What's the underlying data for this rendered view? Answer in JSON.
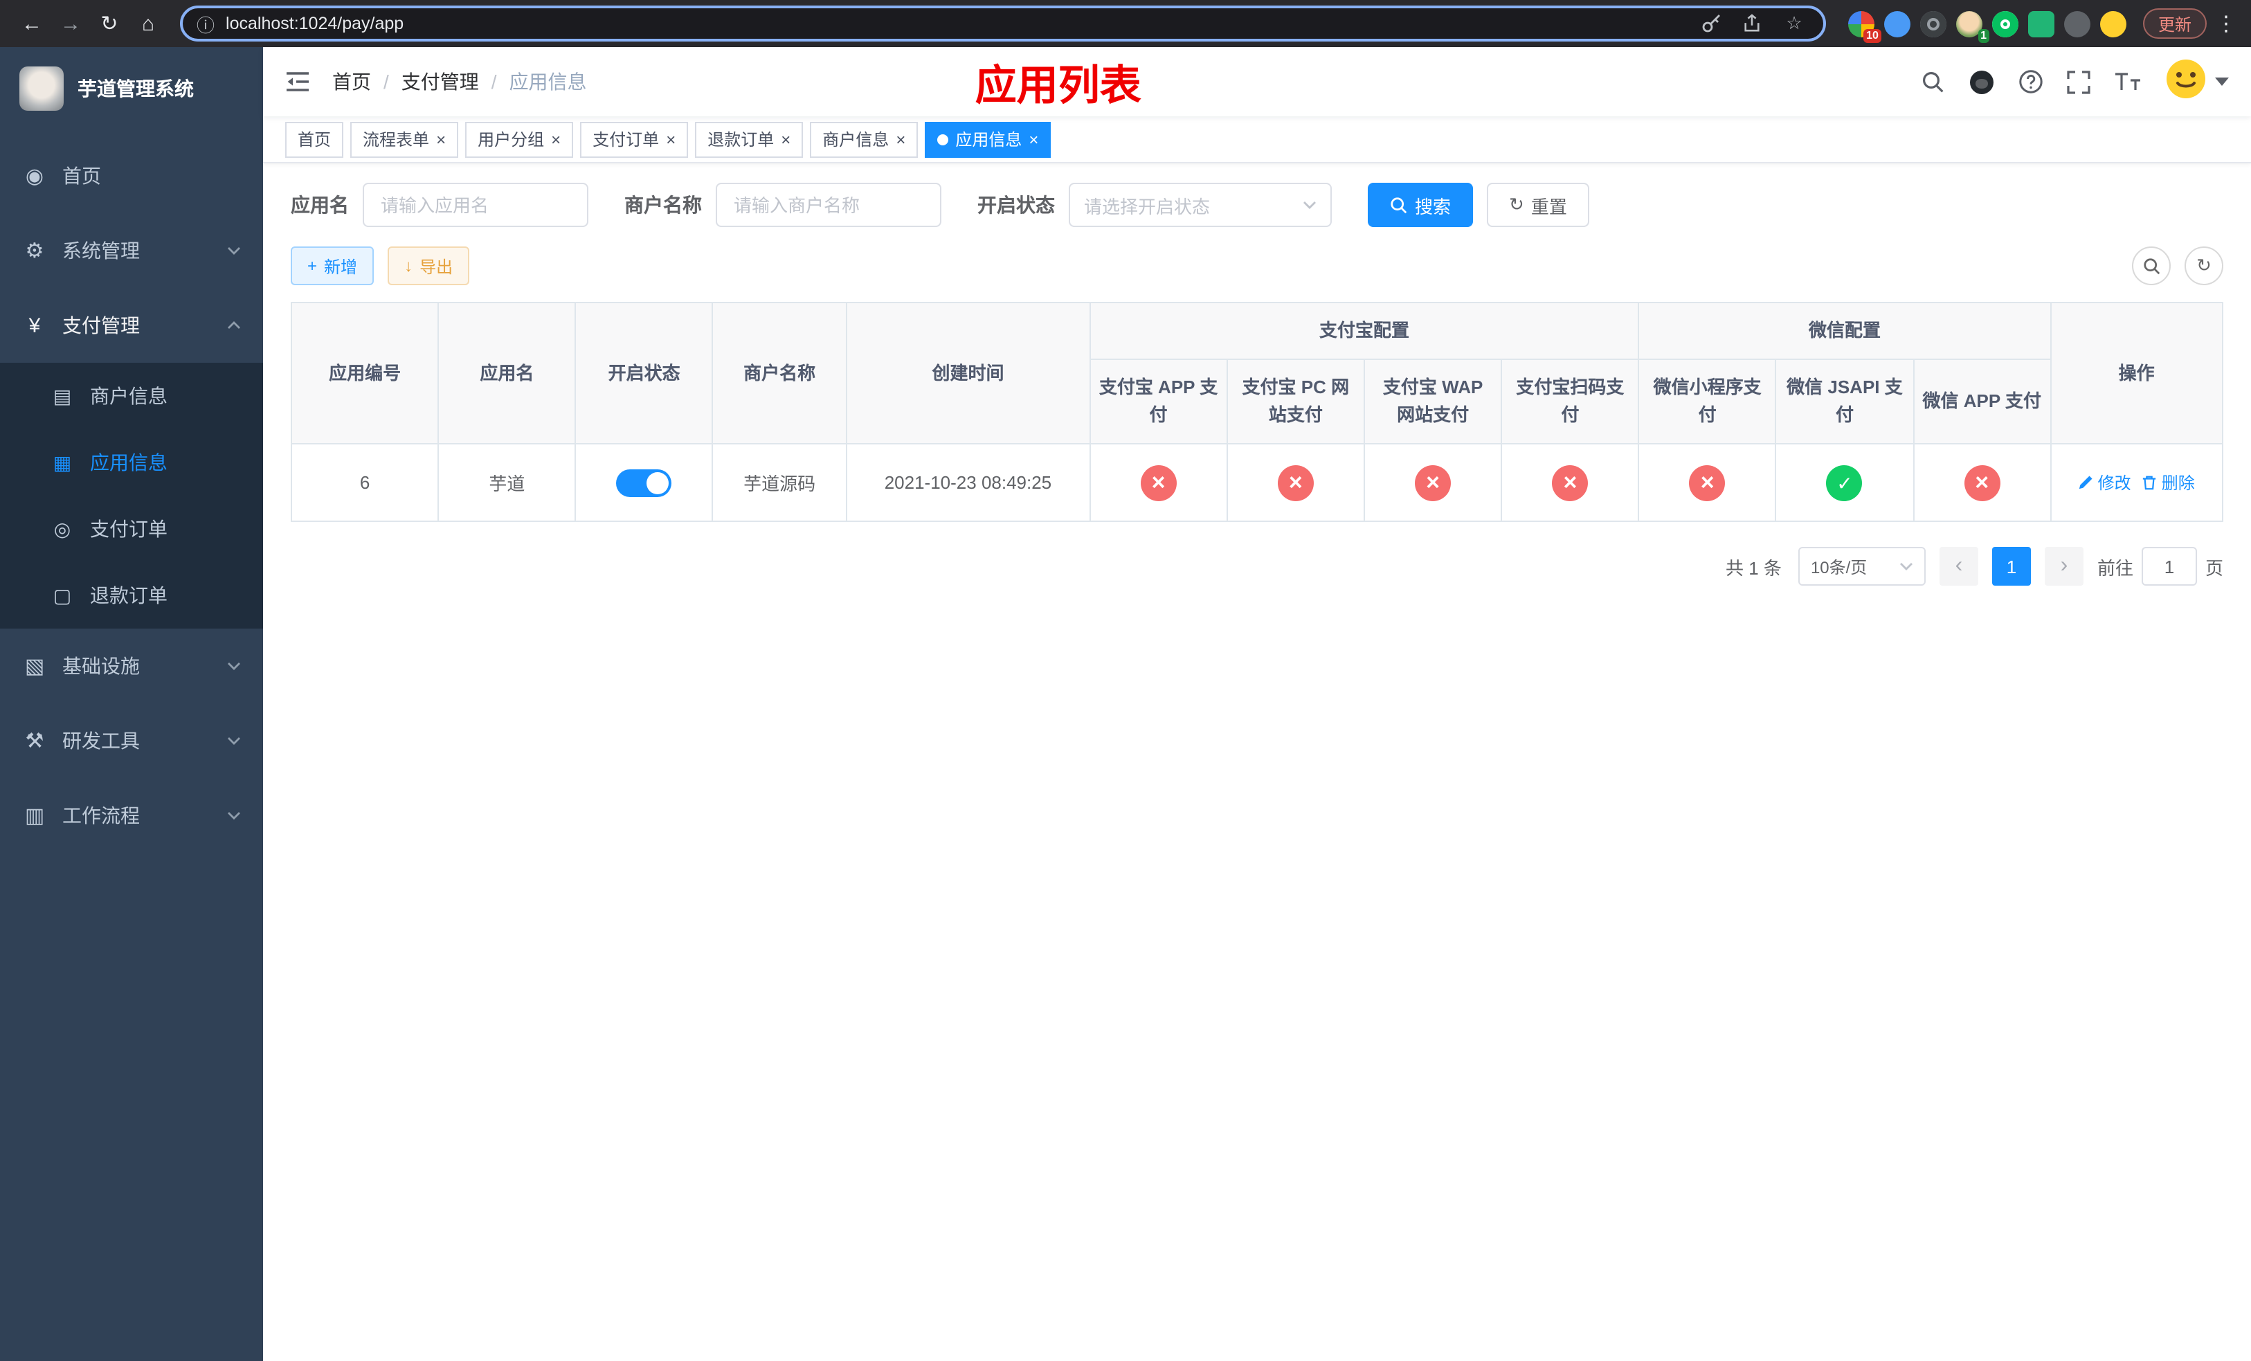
{
  "browser": {
    "url": "localhost:1024/pay/app",
    "update_label": "更新",
    "badge_extensions": "10",
    "badge_profile": "1"
  },
  "glyphs": {
    "back": "←",
    "forward": "→",
    "reload": "↻",
    "home": "⌂",
    "info": "ⓘ",
    "star": "☆",
    "kebab": "⋮",
    "close": "×",
    "plus": "+",
    "download": "↓",
    "refresh": "↻",
    "separator": "/",
    "prev": "‹",
    "next": "›"
  },
  "sidebar": {
    "logo_title": "芋道管理系统",
    "items": [
      {
        "label": "首页",
        "icon": "◉"
      },
      {
        "label": "系统管理",
        "icon": "⚙"
      },
      {
        "label": "支付管理",
        "icon": "¥"
      },
      {
        "label": "商户信息",
        "icon": "▤"
      },
      {
        "label": "应用信息",
        "icon": "▦"
      },
      {
        "label": "支付订单",
        "icon": "◎"
      },
      {
        "label": "退款订单",
        "icon": "▢"
      },
      {
        "label": "基础设施",
        "icon": "▧"
      },
      {
        "label": "研发工具",
        "icon": "⚒"
      },
      {
        "label": "工作流程",
        "icon": "▥"
      }
    ]
  },
  "navbar": {
    "breadcrumb": [
      "首页",
      "支付管理",
      "应用信息"
    ],
    "page_title": "应用列表"
  },
  "tabs": [
    {
      "label": "首页"
    },
    {
      "label": "流程表单"
    },
    {
      "label": "用户分组"
    },
    {
      "label": "支付订单"
    },
    {
      "label": "退款订单"
    },
    {
      "label": "商户信息"
    },
    {
      "label": "应用信息"
    }
  ],
  "filters": {
    "app_name_label": "应用名",
    "app_name_placeholder": "请输入应用名",
    "merchant_label": "商户名称",
    "merchant_placeholder": "请输入商户名称",
    "status_label": "开启状态",
    "status_placeholder": "请选择开启状态",
    "search_label": "搜索",
    "reset_label": "重置"
  },
  "toolbar": {
    "add_label": "新增",
    "export_label": "导出"
  },
  "table": {
    "main_columns": [
      "应用编号",
      "应用名",
      "开启状态",
      "商户名称",
      "创建时间"
    ],
    "alipay_group": "支付宝配置",
    "wechat_group": "微信配置",
    "sub_columns": [
      "支付宝 APP 支付",
      "支付宝 PC 网站支付",
      "支付宝 WAP 网站支付",
      "支付宝扫码支付",
      "微信小程序支付",
      "微信 JSAPI 支付",
      "微信 APP 支付"
    ],
    "ops_column": "操作",
    "row": {
      "id": "6",
      "name": "芋道",
      "merchant": "芋道源码",
      "created": "2021-10-23 08:49:25",
      "configs": [
        "no",
        "no",
        "no",
        "no",
        "no",
        "yes",
        "no"
      ],
      "edit_label": "修改",
      "delete_label": "删除"
    }
  },
  "pagination": {
    "total": "共 1 条",
    "per_page": "10条/页",
    "page": "1",
    "goto_label": "前往",
    "goto_value": "1",
    "unit_label": "页"
  },
  "colors": {
    "primary": "#1890ff",
    "danger": "#f56c6c",
    "success": "#13ce66",
    "title_red": "#f00000",
    "sidebar_bg": "#304156",
    "submenu_bg": "#1f2d3d"
  }
}
